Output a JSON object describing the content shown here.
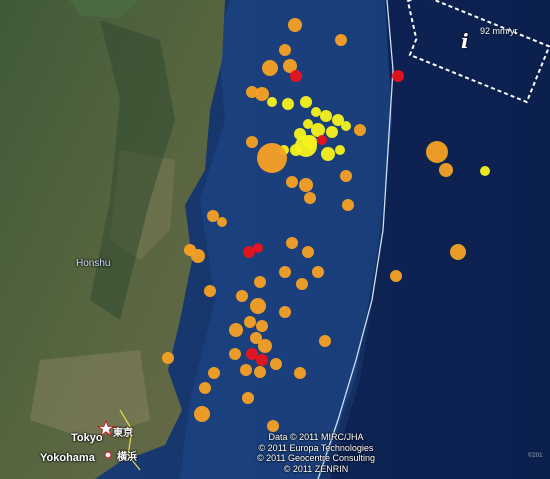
{
  "map": {
    "region_label": "Honshu",
    "cities": [
      {
        "label": "Tokyo",
        "label_local": "東京"
      },
      {
        "label": "Yokohama",
        "label_local": "横浜"
      }
    ],
    "credits": [
      "Data © 2011 MIRC/JHA",
      "© 2011 Europa Technologies",
      "© 2011 Geocentre Consulting",
      "© 2011 ZENRIN"
    ],
    "plate_motion": {
      "rate_label": "92 mm/yr",
      "info_symbol": "i"
    },
    "corner_text": "©201",
    "colors": {
      "ocean": "#16336a",
      "land": "#4a5a3c",
      "trench_line": "#cfe0f2",
      "quake_red": "#e8141c",
      "quake_orange": "#f7a124",
      "quake_yellow": "#f7f31c"
    }
  }
}
